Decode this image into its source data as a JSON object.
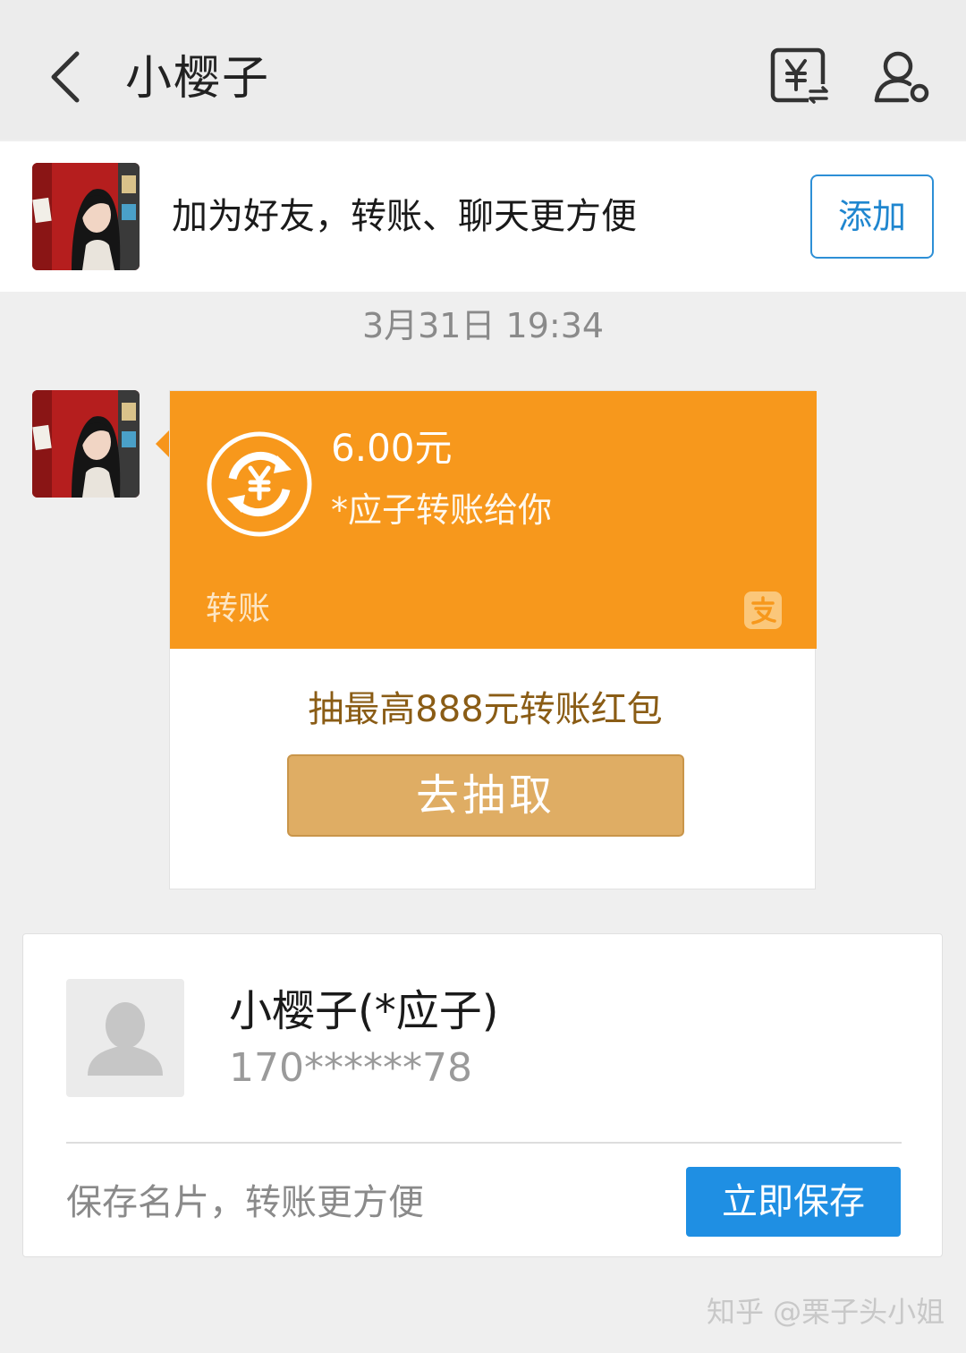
{
  "header": {
    "title": "小樱子",
    "back_icon": "chevron-left-icon",
    "transfer_icon": "yuan-transfer-icon",
    "profile_icon": "user-settings-icon"
  },
  "add_banner": {
    "text": "加为好友，转账、聊天更方便",
    "add_button": "添加"
  },
  "timestamp": "3月31日 19:34",
  "transfer_card": {
    "amount": "6.00元",
    "sender_text": "*应子转账给你",
    "label": "转账",
    "promo": "抽最高888元转账红包",
    "draw_button": "去抽取",
    "brand_icon": "alipay-icon"
  },
  "contact_card": {
    "name": "小樱子(*应子)",
    "phone": "170******78",
    "hint": "保存名片，转账更方便",
    "save_button": "立即保存"
  },
  "watermark": "知乎 @栗子头小姐",
  "colors": {
    "transfer_orange": "#f7981c",
    "draw_button_gold": "#dfad64",
    "save_blue": "#1f8fe3",
    "add_blue": "#2d8fd6"
  }
}
